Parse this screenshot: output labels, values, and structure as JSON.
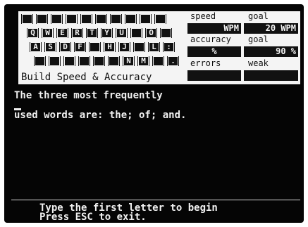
{
  "keyboard": {
    "row1": [
      "",
      "",
      "",
      "",
      "",
      "",
      "",
      "",
      "",
      ""
    ],
    "row2": [
      "Q",
      "W",
      "E",
      "R",
      "T",
      "Y",
      "U",
      "",
      "O",
      ""
    ],
    "row3": [
      "A",
      "S",
      "D",
      "F",
      "",
      "H",
      "J",
      "",
      "L",
      ":"
    ],
    "row4": [
      "",
      "",
      "",
      "",
      "",
      "",
      "N",
      "M",
      "",
      "."
    ]
  },
  "panel_title": "Build Speed & Accuracy",
  "stats": {
    "speed_label": "speed",
    "speed_goal_label": "goal",
    "speed_value": "WPM",
    "speed_goal_value": "20 WPM",
    "accuracy_label": "accuracy",
    "accuracy_goal_label": "goal",
    "accuracy_value": "%",
    "accuracy_goal_value": "90 %",
    "errors_label": "errors",
    "weak_label": "weak",
    "errors_value": "",
    "weak_value": ""
  },
  "lesson": {
    "line1": "The three most frequently",
    "line2": "used words are: the; of; and."
  },
  "footer": {
    "line1": "Type the first letter to begin",
    "line2": "Press ESC to exit."
  },
  "colors": {
    "screen_bg": "#050505",
    "text": "#f0f0f0",
    "panel": "#f4f4f4"
  }
}
